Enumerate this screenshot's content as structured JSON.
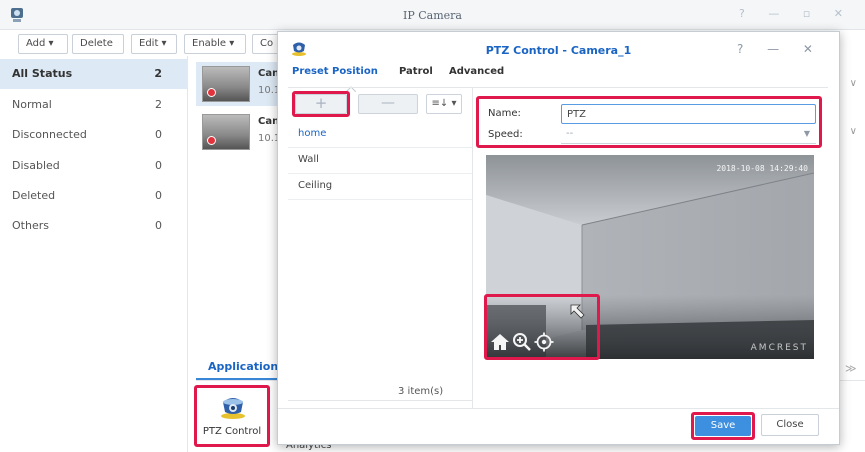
{
  "window": {
    "title": "IP Camera"
  },
  "toolbar": {
    "add": "Add ▾",
    "delete": "Delete",
    "edit": "Edit ▾",
    "enable": "Enable ▾",
    "configure": "Co"
  },
  "sidebar": {
    "items": [
      {
        "label": "All Status",
        "count": "2"
      },
      {
        "label": "Normal",
        "count": "2"
      },
      {
        "label": "Disconnected",
        "count": "0"
      },
      {
        "label": "Disabled",
        "count": "0"
      },
      {
        "label": "Deleted",
        "count": "0"
      },
      {
        "label": "Others",
        "count": "0"
      }
    ]
  },
  "cameras": [
    {
      "name": "Can",
      "ip": "10.1"
    },
    {
      "name": "Can",
      "ip": "10.1"
    }
  ],
  "applications": {
    "tab_label": "Applications",
    "tile_label": "PTZ Control",
    "analytics_label": "Analytics"
  },
  "dialog": {
    "title": "PTZ Control - Camera_1",
    "tabs": [
      "Preset Position",
      "Patrol",
      "Advanced"
    ],
    "presets": [
      "home",
      "Wall",
      "Ceiling"
    ],
    "items_count": "3 item(s)",
    "name_label": "Name:",
    "name_value": "PTZ",
    "speed_label": "Speed:",
    "speed_value": "--",
    "video_timestamp": "2018-10-08 14:29:40",
    "video_logo": "AMCREST",
    "save_label": "Save",
    "close_label": "Close"
  },
  "colors": {
    "accent": "#3d8fe0",
    "highlight": "#e0194d",
    "selected_bg": "#dde9f4",
    "status_red": "#e2333c"
  }
}
